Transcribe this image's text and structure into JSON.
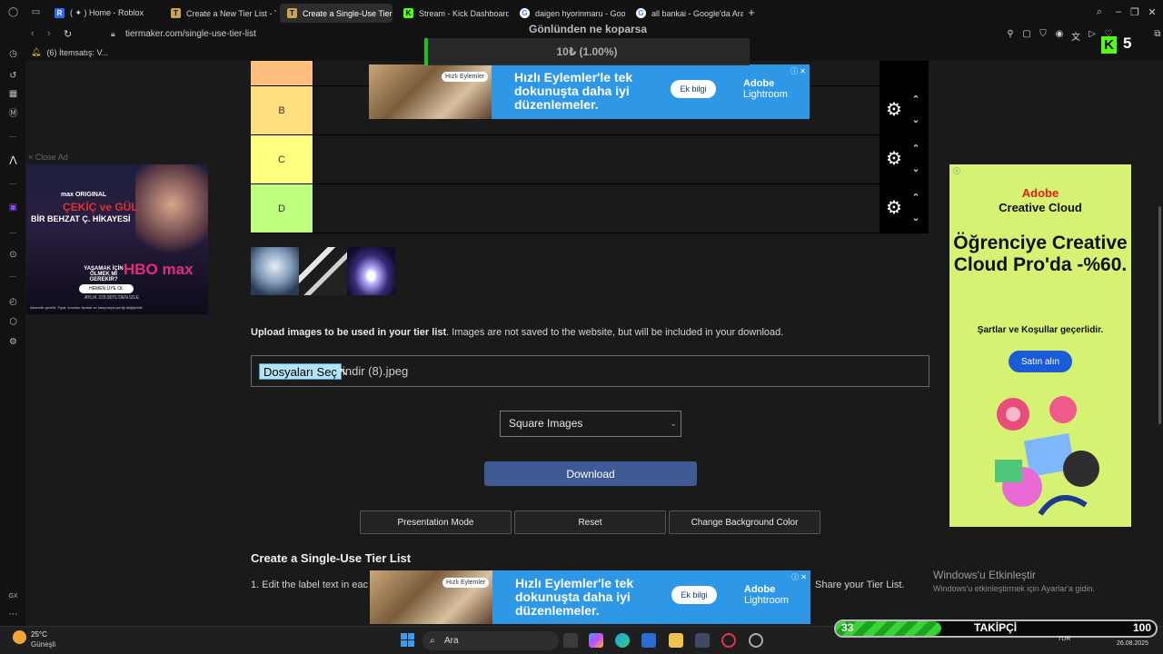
{
  "browser": {
    "tabs": [
      {
        "title": "( ✦ ) Home - Roblox"
      },
      {
        "title": "Create a New Tier List - T"
      },
      {
        "title": "Create a Single-Use Tier"
      },
      {
        "title": "Stream - Kick Dashboard"
      },
      {
        "title": "daigen hyorinmaru - Goo"
      },
      {
        "title": "all bankai - Google'da Ara"
      }
    ],
    "url": "tiermaker.com/single-use-tier-list",
    "bookmark": "(6) İtemsatış: V..."
  },
  "tiers": [
    {
      "label": "B",
      "color": "#ffdf80"
    },
    {
      "label": "C",
      "color": "#ffff7f"
    },
    {
      "label": "D",
      "color": "#bfff7f"
    }
  ],
  "upload": {
    "bold": "Upload images to be used in your tier list",
    "rest": ". Images are not saved to the website, but will be included in your download.",
    "file_button": "Dosyaları Seç",
    "file_name": "indir (8).jpeg"
  },
  "select": {
    "value": "Square Images"
  },
  "buttons": {
    "download": "Download",
    "presentation": "Presentation Mode",
    "reset": "Reset",
    "bg_color": "Change Background Color"
  },
  "section": {
    "title": "Create a Single-Use Tier List",
    "instruction_start": "1. Edit the label text in eac",
    "instruction_end": "Share your Tier List."
  },
  "ads": {
    "lightroom": {
      "chip": "Hızlı Eylemler",
      "headline": "Hızlı Eylemler'le tek dokunuşta daha iyi düzenlemeler.",
      "cta": "Ek bilgi",
      "brand1": "Adobe",
      "brand2": "Lightroom"
    },
    "hbo": {
      "close": "× Close Ad",
      "top": "max ORIGINAL",
      "title": "BİR BEHZAT Ç. HİKAYESİ",
      "red": "ÇEKİÇ ve GÜL",
      "tag": "YAŞAMAK İÇİN ÖLMEK Mİ GEREKİR?",
      "logo": "HBO max",
      "btn": "HEMEN ÜYE OL",
      "price": "AYLIK 229,90TL'DEN İZLE",
      "fine": "Abonelik gerekli. Fiyat, sunulan fiyatlar ve kampanya içeriği değişebilir."
    },
    "adobe": {
      "brand1": "Adobe",
      "brand2": "Creative Cloud",
      "big": "Öğrenciye Creative Cloud Pro'da -%60.",
      "small": "Şartlar ve Koşullar geçerlidir.",
      "cta": "Satın alın"
    }
  },
  "overlay": {
    "title": "Gönlünden ne koparsa",
    "progress": "10₺ (1.00%)",
    "progress_fraction": 0.01,
    "kick_count": "5",
    "follow_label": "TAKİPÇİ",
    "follow_current": "33",
    "follow_goal": "100",
    "follow_fraction": 0.33
  },
  "windows": {
    "activate_title": "Windows'u Etkinleştir",
    "activate_desc": "Windows'u etkinleştirmek için Ayarlar'a gidin.",
    "weather_temp": "25°C",
    "weather_desc": "Güneşli",
    "search": "Ara",
    "lang": "TUR",
    "date": "26.08.2025"
  }
}
